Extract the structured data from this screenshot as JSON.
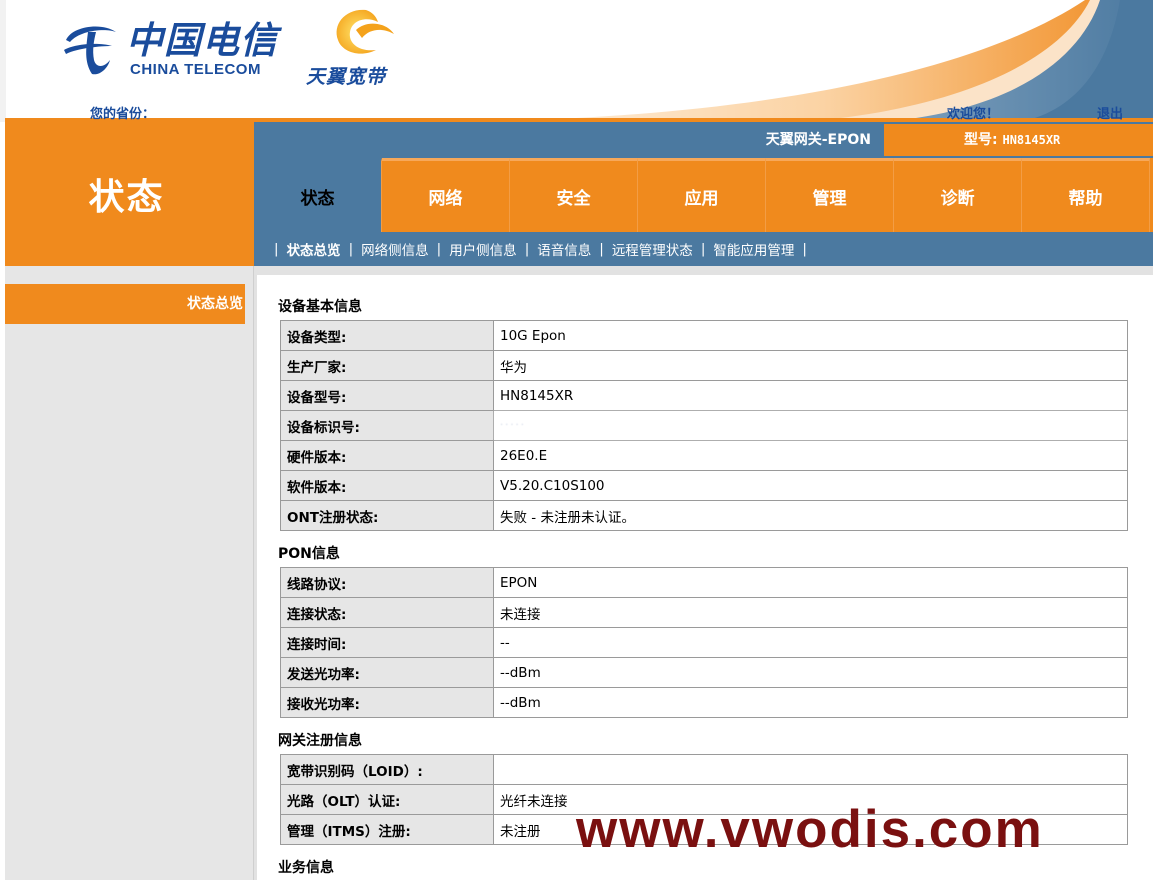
{
  "header": {
    "brand_cn": "中国电信",
    "brand_en": "CHINA TELECOM",
    "broadband_brand": "天翼宽带",
    "province_label": "您的省份：",
    "welcome": "欢迎您！",
    "logout": "退出"
  },
  "section_title": "状态",
  "gateway": {
    "name": "天翼网关-EPON",
    "model_label": "型号:",
    "model_value": "HN8145XR"
  },
  "tabs": [
    {
      "label": "状态",
      "active": true
    },
    {
      "label": "网络"
    },
    {
      "label": "安全"
    },
    {
      "label": "应用"
    },
    {
      "label": "管理"
    },
    {
      "label": "诊断"
    },
    {
      "label": "帮助"
    }
  ],
  "subnav": [
    {
      "label": "状态总览",
      "active": true
    },
    {
      "label": "网络侧信息"
    },
    {
      "label": "用户侧信息"
    },
    {
      "label": "语音信息"
    },
    {
      "label": "远程管理状态"
    },
    {
      "label": "智能应用管理"
    }
  ],
  "sidebar": {
    "items": [
      {
        "label": "状态总览"
      }
    ]
  },
  "device_info": {
    "title": "设备基本信息",
    "rows": [
      {
        "label": "设备类型:",
        "value": "10G Epon"
      },
      {
        "label": "生产厂家:",
        "value": "华为"
      },
      {
        "label": "设备型号:",
        "value": "HN8145XR"
      },
      {
        "label": "设备标识号:",
        "value": "·····"
      },
      {
        "label": "硬件版本:",
        "value": "26E0.E"
      },
      {
        "label": "软件版本:",
        "value": "V5.20.C10S100"
      },
      {
        "label": "ONT注册状态:",
        "value": "失败 - 未注册未认证。"
      }
    ]
  },
  "pon_info": {
    "title": "PON信息",
    "rows": [
      {
        "label": "线路协议:",
        "value": "EPON"
      },
      {
        "label": "连接状态:",
        "value": "未连接"
      },
      {
        "label": "连接时间:",
        "value": "--"
      },
      {
        "label": "发送光功率:",
        "value": "--dBm"
      },
      {
        "label": "接收光功率:",
        "value": "--dBm"
      }
    ]
  },
  "gw_reg_info": {
    "title": "网关注册信息",
    "rows": [
      {
        "label": "宽带识别码（LOID）:",
        "value": ""
      },
      {
        "label": "光路（OLT）认证:",
        "value": "光纤未连接"
      },
      {
        "label": "管理（ITMS）注册:",
        "value": "未注册"
      }
    ]
  },
  "service_info": {
    "title": "业务信息"
  },
  "watermark": "www.vwodis.com",
  "colors": {
    "orange": "#f08a1d",
    "steel_blue": "#4b79a0",
    "brand_blue": "#1a4c9c",
    "watermark": "#7a1010"
  }
}
